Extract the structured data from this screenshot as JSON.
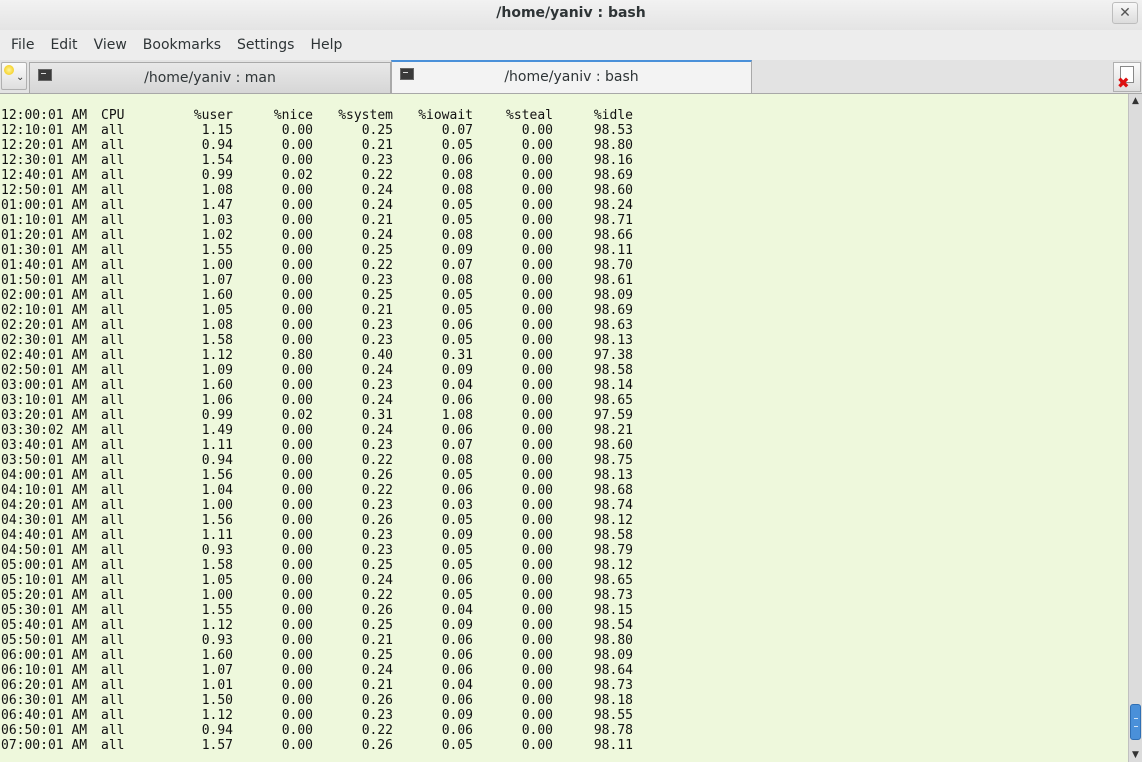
{
  "window": {
    "title": "/home/yaniv : bash",
    "close_glyph": "✕"
  },
  "menu": {
    "items": [
      "File",
      "Edit",
      "View",
      "Bookmarks",
      "Settings",
      "Help"
    ]
  },
  "tabs": [
    {
      "label": "/home/yaniv : man",
      "active": false
    },
    {
      "label": "/home/yaniv : bash",
      "active": true
    }
  ],
  "terminal": {
    "columns": [
      "12:00:01 AM",
      "CPU",
      "%user",
      "%nice",
      "%system",
      "%iowait",
      "%steal",
      "%idle"
    ],
    "rows": [
      [
        "12:10:01 AM",
        "all",
        "1.15",
        "0.00",
        "0.25",
        "0.07",
        "0.00",
        "98.53"
      ],
      [
        "12:20:01 AM",
        "all",
        "0.94",
        "0.00",
        "0.21",
        "0.05",
        "0.00",
        "98.80"
      ],
      [
        "12:30:01 AM",
        "all",
        "1.54",
        "0.00",
        "0.23",
        "0.06",
        "0.00",
        "98.16"
      ],
      [
        "12:40:01 AM",
        "all",
        "0.99",
        "0.02",
        "0.22",
        "0.08",
        "0.00",
        "98.69"
      ],
      [
        "12:50:01 AM",
        "all",
        "1.08",
        "0.00",
        "0.24",
        "0.08",
        "0.00",
        "98.60"
      ],
      [
        "01:00:01 AM",
        "all",
        "1.47",
        "0.00",
        "0.24",
        "0.05",
        "0.00",
        "98.24"
      ],
      [
        "01:10:01 AM",
        "all",
        "1.03",
        "0.00",
        "0.21",
        "0.05",
        "0.00",
        "98.71"
      ],
      [
        "01:20:01 AM",
        "all",
        "1.02",
        "0.00",
        "0.24",
        "0.08",
        "0.00",
        "98.66"
      ],
      [
        "01:30:01 AM",
        "all",
        "1.55",
        "0.00",
        "0.25",
        "0.09",
        "0.00",
        "98.11"
      ],
      [
        "01:40:01 AM",
        "all",
        "1.00",
        "0.00",
        "0.22",
        "0.07",
        "0.00",
        "98.70"
      ],
      [
        "01:50:01 AM",
        "all",
        "1.07",
        "0.00",
        "0.23",
        "0.08",
        "0.00",
        "98.61"
      ],
      [
        "02:00:01 AM",
        "all",
        "1.60",
        "0.00",
        "0.25",
        "0.05",
        "0.00",
        "98.09"
      ],
      [
        "02:10:01 AM",
        "all",
        "1.05",
        "0.00",
        "0.21",
        "0.05",
        "0.00",
        "98.69"
      ],
      [
        "02:20:01 AM",
        "all",
        "1.08",
        "0.00",
        "0.23",
        "0.06",
        "0.00",
        "98.63"
      ],
      [
        "02:30:01 AM",
        "all",
        "1.58",
        "0.00",
        "0.23",
        "0.05",
        "0.00",
        "98.13"
      ],
      [
        "02:40:01 AM",
        "all",
        "1.12",
        "0.80",
        "0.40",
        "0.31",
        "0.00",
        "97.38"
      ],
      [
        "02:50:01 AM",
        "all",
        "1.09",
        "0.00",
        "0.24",
        "0.09",
        "0.00",
        "98.58"
      ],
      [
        "03:00:01 AM",
        "all",
        "1.60",
        "0.00",
        "0.23",
        "0.04",
        "0.00",
        "98.14"
      ],
      [
        "03:10:01 AM",
        "all",
        "1.06",
        "0.00",
        "0.24",
        "0.06",
        "0.00",
        "98.65"
      ],
      [
        "03:20:01 AM",
        "all",
        "0.99",
        "0.02",
        "0.31",
        "1.08",
        "0.00",
        "97.59"
      ],
      [
        "03:30:02 AM",
        "all",
        "1.49",
        "0.00",
        "0.24",
        "0.06",
        "0.00",
        "98.21"
      ],
      [
        "03:40:01 AM",
        "all",
        "1.11",
        "0.00",
        "0.23",
        "0.07",
        "0.00",
        "98.60"
      ],
      [
        "03:50:01 AM",
        "all",
        "0.94",
        "0.00",
        "0.22",
        "0.08",
        "0.00",
        "98.75"
      ],
      [
        "04:00:01 AM",
        "all",
        "1.56",
        "0.00",
        "0.26",
        "0.05",
        "0.00",
        "98.13"
      ],
      [
        "04:10:01 AM",
        "all",
        "1.04",
        "0.00",
        "0.22",
        "0.06",
        "0.00",
        "98.68"
      ],
      [
        "04:20:01 AM",
        "all",
        "1.00",
        "0.00",
        "0.23",
        "0.03",
        "0.00",
        "98.74"
      ],
      [
        "04:30:01 AM",
        "all",
        "1.56",
        "0.00",
        "0.26",
        "0.05",
        "0.00",
        "98.12"
      ],
      [
        "04:40:01 AM",
        "all",
        "1.11",
        "0.00",
        "0.23",
        "0.09",
        "0.00",
        "98.58"
      ],
      [
        "04:50:01 AM",
        "all",
        "0.93",
        "0.00",
        "0.23",
        "0.05",
        "0.00",
        "98.79"
      ],
      [
        "05:00:01 AM",
        "all",
        "1.58",
        "0.00",
        "0.25",
        "0.05",
        "0.00",
        "98.12"
      ],
      [
        "05:10:01 AM",
        "all",
        "1.05",
        "0.00",
        "0.24",
        "0.06",
        "0.00",
        "98.65"
      ],
      [
        "05:20:01 AM",
        "all",
        "1.00",
        "0.00",
        "0.22",
        "0.05",
        "0.00",
        "98.73"
      ],
      [
        "05:30:01 AM",
        "all",
        "1.55",
        "0.00",
        "0.26",
        "0.04",
        "0.00",
        "98.15"
      ],
      [
        "05:40:01 AM",
        "all",
        "1.12",
        "0.00",
        "0.25",
        "0.09",
        "0.00",
        "98.54"
      ],
      [
        "05:50:01 AM",
        "all",
        "0.93",
        "0.00",
        "0.21",
        "0.06",
        "0.00",
        "98.80"
      ],
      [
        "06:00:01 AM",
        "all",
        "1.60",
        "0.00",
        "0.25",
        "0.06",
        "0.00",
        "98.09"
      ],
      [
        "06:10:01 AM",
        "all",
        "1.07",
        "0.00",
        "0.24",
        "0.06",
        "0.00",
        "98.64"
      ],
      [
        "06:20:01 AM",
        "all",
        "1.01",
        "0.00",
        "0.21",
        "0.04",
        "0.00",
        "98.73"
      ],
      [
        "06:30:01 AM",
        "all",
        "1.50",
        "0.00",
        "0.26",
        "0.06",
        "0.00",
        "98.18"
      ],
      [
        "06:40:01 AM",
        "all",
        "1.12",
        "0.00",
        "0.23",
        "0.09",
        "0.00",
        "98.55"
      ],
      [
        "06:50:01 AM",
        "all",
        "0.94",
        "0.00",
        "0.22",
        "0.06",
        "0.00",
        "98.78"
      ],
      [
        "07:00:01 AM",
        "all",
        "1.57",
        "0.00",
        "0.26",
        "0.05",
        "0.00",
        "98.11"
      ]
    ]
  }
}
